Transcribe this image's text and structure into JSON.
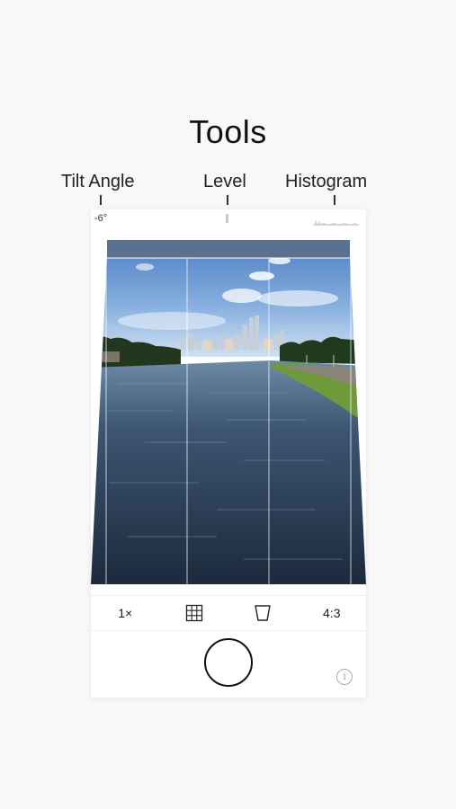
{
  "heading": "Tools",
  "callouts": {
    "tilt_angle": "Tilt Angle",
    "level": "Level",
    "histogram": "Histogram"
  },
  "camera": {
    "tilt_value": "-6°",
    "toolbar": {
      "zoom_label": "1×",
      "grid_icon": "grid-icon",
      "perspective_icon": "trapezoid-icon",
      "aspect_label": "4:3"
    },
    "shutter_icon": "shutter-button",
    "info_glyph": "i",
    "colors": {
      "sky_top": "#4d7fc4",
      "sky_bottom": "#cfe0f1",
      "water": "#2c3e55",
      "grass": "#6e9a3c"
    }
  }
}
